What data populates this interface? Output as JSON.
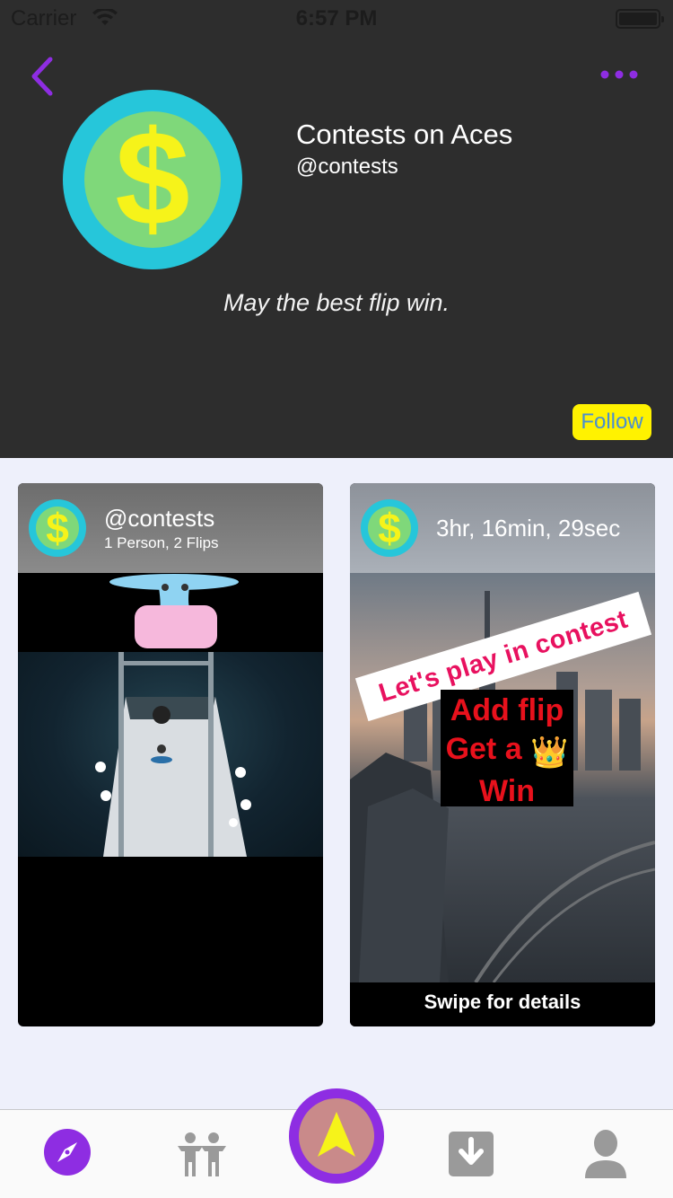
{
  "status_bar": {
    "carrier": "Carrier",
    "time": "6:57 PM"
  },
  "profile": {
    "name": "Contests on Aces",
    "handle": "@contests",
    "tagline": "May the best flip win.",
    "follow_label": "Follow"
  },
  "cards": [
    {
      "handle": "@contests",
      "subtitle": "1 Person, 2 Flips"
    },
    {
      "timer": "3hr, 16min, 29sec",
      "banner_text": "Let's play in contest",
      "overlay_line1": "Add flip",
      "overlay_line2": "Get a",
      "overlay_line3": "Win",
      "crown_emoji": "👑",
      "swipe_label": "Swipe for details"
    }
  ],
  "tabbar": {
    "items": [
      "discover-icon",
      "people-icon",
      "create-arrow-icon",
      "download-icon",
      "profile-icon"
    ]
  },
  "colors": {
    "accent": "#8e2de2",
    "follow_bg": "#fff200",
    "follow_text": "#4a8fd0",
    "header_bg": "#2d2d2d",
    "coin_ring": "#26c6da",
    "coin_face": "#7fd87a",
    "coin_symbol": "#f6f31a",
    "banner_text": "#e8115f",
    "overlay_text": "#e8111c"
  }
}
